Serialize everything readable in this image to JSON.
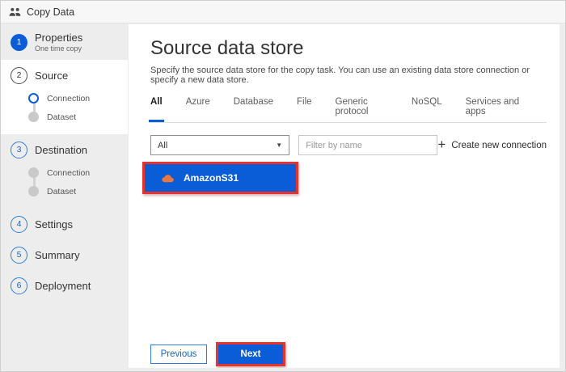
{
  "window": {
    "title": "Copy Data"
  },
  "colors": {
    "accent_blue": "#0a5dd6",
    "annotation_red": "#e8322e",
    "amazon_s3_orange": "#e87840",
    "step_outline_blue": "#2f7ed3"
  },
  "sidebar": {
    "steps": [
      {
        "num": "1",
        "label": "Properties",
        "sublabel": "One time copy",
        "state": "completed"
      },
      {
        "num": "2",
        "label": "Source",
        "state": "current",
        "substeps": [
          {
            "label": "Connection",
            "state": "current"
          },
          {
            "label": "Dataset",
            "state": "pending"
          }
        ]
      },
      {
        "num": "3",
        "label": "Destination",
        "state": "upcoming",
        "substeps": [
          {
            "label": "Connection",
            "state": "pending"
          },
          {
            "label": "Dataset",
            "state": "pending"
          }
        ]
      },
      {
        "num": "4",
        "label": "Settings",
        "state": "upcoming"
      },
      {
        "num": "5",
        "label": "Summary",
        "state": "upcoming"
      },
      {
        "num": "6",
        "label": "Deployment",
        "state": "upcoming"
      }
    ]
  },
  "main": {
    "title": "Source data store",
    "description": "Specify the source data store for the copy task. You can use an existing data store connection or specify a new data store.",
    "tabs": [
      "All",
      "Azure",
      "Database",
      "File",
      "Generic protocol",
      "NoSQL",
      "Services and apps"
    ],
    "active_tab": "All",
    "type_filter_value": "All",
    "filter_placeholder": "Filter by name",
    "create_new_connection_label": "Create new connection",
    "connections": [
      {
        "name": "AmazonS31",
        "icon": "amazon-s3-cloud",
        "selected": true
      }
    ],
    "buttons": {
      "previous": "Previous",
      "next": "Next"
    }
  }
}
